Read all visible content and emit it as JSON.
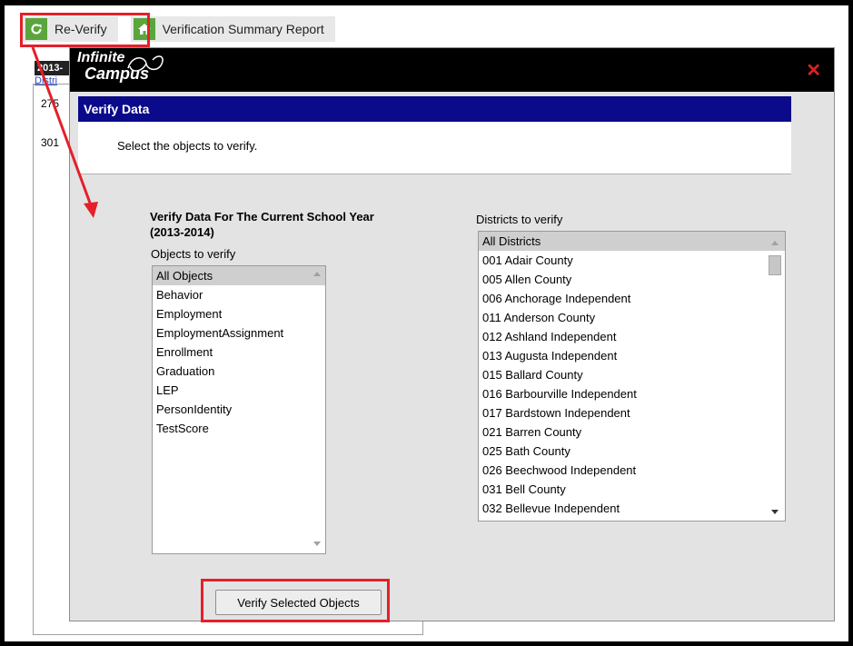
{
  "toolbar": {
    "reverify_label": "Re-Verify",
    "summary_label": "Verification Summary Report"
  },
  "background": {
    "year_fragment": "2013-",
    "link_fragment": "Distri",
    "value1": "275",
    "value2": "301"
  },
  "modal": {
    "logo_line1": "Infinite",
    "logo_line2": "Campus",
    "title": "Verify Data",
    "instruction": "Select the objects to verify.",
    "heading_line1": "Verify Data For The Current School Year",
    "heading_line2": "(2013-2014)",
    "objects_label": "Objects to verify",
    "districts_label": "Districts to verify",
    "verify_button_label": "Verify Selected Objects"
  },
  "objects": [
    "All Objects",
    "Behavior",
    "Employment",
    "EmploymentAssignment",
    "Enrollment",
    "Graduation",
    "LEP",
    "PersonIdentity",
    "TestScore"
  ],
  "districts": [
    "All Districts",
    "001 Adair County",
    "005 Allen County",
    "006 Anchorage Independent",
    "011 Anderson County",
    "012 Ashland Independent",
    "013 Augusta Independent",
    "015 Ballard County",
    "016 Barbourville Independent",
    "017 Bardstown Independent",
    "021 Barren County",
    "025 Bath County",
    "026 Beechwood Independent",
    "031 Bell County",
    "032 Bellevue Independent"
  ],
  "colors": {
    "highlight": "#e4202a",
    "title_bar": "#0a0a8a",
    "icon_green": "#5aa53c",
    "close": "#e0201e"
  },
  "icons": {
    "reverify": "refresh-icon",
    "summary": "home-icon",
    "close": "close-icon"
  }
}
